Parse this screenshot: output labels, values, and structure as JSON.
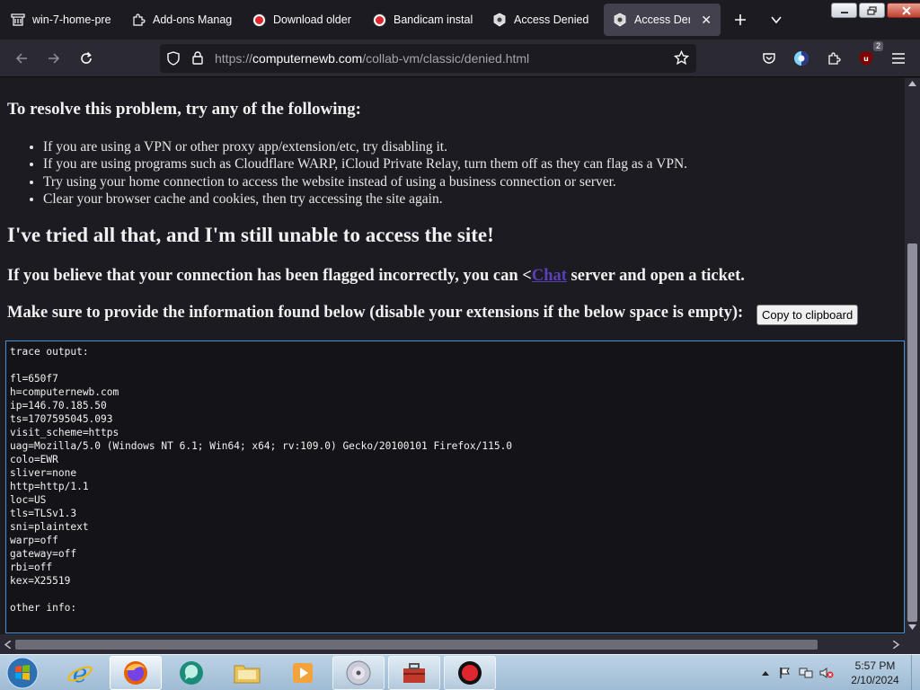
{
  "tabs": [
    {
      "label": "win-7-home-pre",
      "icon": "archive-icon"
    },
    {
      "label": "Add-ons Manage",
      "icon": "puzzle-icon"
    },
    {
      "label": "Download older",
      "icon": "record-icon"
    },
    {
      "label": "Bandicam install",
      "icon": "record-icon"
    },
    {
      "label": "Access Denied",
      "icon": "vm-icon"
    },
    {
      "label": "Access Denied",
      "icon": "vm-icon",
      "active": true
    }
  ],
  "url": {
    "prefix": "https://",
    "domain": "computernewb.com",
    "path": "/collab-vm/classic/denied.html"
  },
  "extensions_badge": "2",
  "page": {
    "resolve_heading": "To resolve this problem, try any of the following:",
    "tips": [
      "If you are using a VPN or other proxy app/extension/etc, try disabling it.",
      "If you are using programs such as Cloudflare WARP, iCloud Private Relay, turn them off as they can flag as a VPN.",
      "Try using your home connection to access the website instead of using a business connection or server.",
      "Clear your browser cache and cookies, then try accessing the site again."
    ],
    "tried_heading": "I've tried all that, and I'm still unable to access the site!",
    "believe_prefix": "If you believe that your connection has been flagged incorrectly, you can <",
    "chat_link": "Chat",
    "believe_suffix": " server and open a ticket.",
    "make_sure": "Make sure to provide the information found below (disable your extensions if the below space is empty):",
    "copy_button": "Copy to clipboard",
    "trace_output": "trace output:\n\nfl=650f7\nh=computernewb.com\nip=146.70.185.50\nts=1707595045.093\nvisit_scheme=https\nuag=Mozilla/5.0 (Windows NT 6.1; Win64; x64; rv:109.0) Gecko/20100101 Firefox/115.0\ncolo=EWR\nsliver=none\nhttp=http/1.1\nloc=US\ntls=TLSv1.3\nsni=plaintext\nwarp=off\ngateway=off\nrbi=off\nkex=X25519\n\nother info:"
  },
  "clock": {
    "time": "5:57 PM",
    "date": "2/10/2024"
  },
  "colors": {
    "accent": "#4a90d9",
    "link": "#5b3fb6",
    "background": "#1c1b22"
  }
}
